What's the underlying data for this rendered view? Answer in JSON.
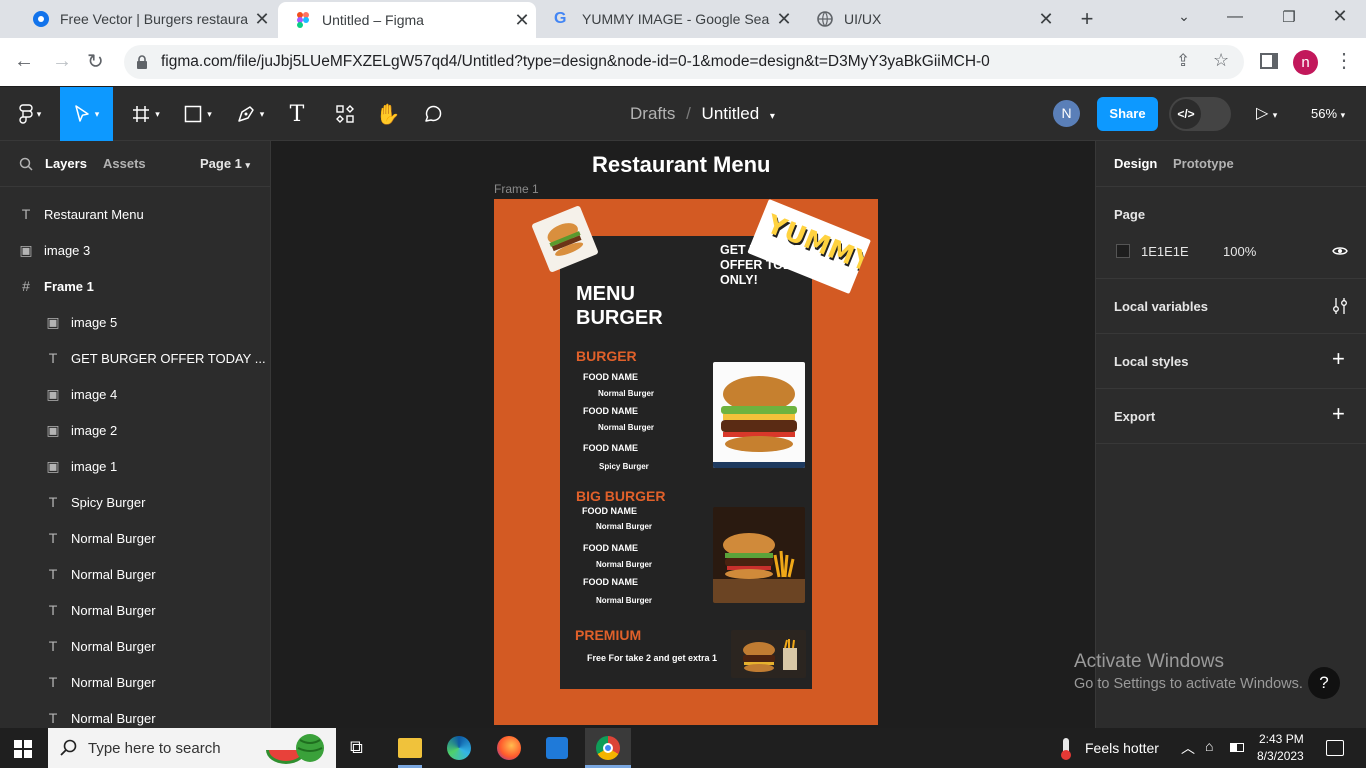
{
  "browser": {
    "tabs": [
      {
        "title": "Free Vector | Burgers restaurant"
      },
      {
        "title": "Untitled – Figma"
      },
      {
        "title": "YUMMY IMAGE - Google Search"
      },
      {
        "title": "UI/UX"
      }
    ],
    "url": "figma.com/file/juJbj5LUeMFXZELgW57qd4/Untitled?type=design&node-id=0-1&mode=design&t=D3MyY3yaBkGiiMCH-0",
    "profile_initial": "n"
  },
  "figma": {
    "breadcrumb_drafts": "Drafts",
    "breadcrumb_sep": "/",
    "file_name": "Untitled",
    "user_initial": "N",
    "share_label": "Share",
    "zoom": "56%",
    "left_tabs": {
      "layers": "Layers",
      "assets": "Assets",
      "page": "Page 1"
    },
    "layers": [
      {
        "name": "Restaurant Menu",
        "icon": "text-icon"
      },
      {
        "name": "image 3",
        "icon": "image-icon"
      },
      {
        "name": "Frame 1",
        "icon": "frame-icon"
      },
      {
        "name": "image 5",
        "icon": "image-icon"
      },
      {
        "name": "GET BURGER OFFER TODAY ...",
        "icon": "text-icon"
      },
      {
        "name": "image 4",
        "icon": "image-icon"
      },
      {
        "name": "image 2",
        "icon": "image-icon"
      },
      {
        "name": "image 1",
        "icon": "image-icon"
      },
      {
        "name": "Spicy Burger",
        "icon": "text-icon"
      },
      {
        "name": "Normal Burger",
        "icon": "text-icon"
      },
      {
        "name": "Normal Burger",
        "icon": "text-icon"
      },
      {
        "name": "Normal Burger",
        "icon": "text-icon"
      },
      {
        "name": "Normal Burger",
        "icon": "text-icon"
      },
      {
        "name": "Normal Burger",
        "icon": "text-icon"
      },
      {
        "name": "Normal Burger",
        "icon": "text-icon"
      }
    ],
    "right_tabs": {
      "design": "Design",
      "prototype": "Prototype"
    },
    "page_section": {
      "title": "Page",
      "color_hex": "1E1E1E",
      "opacity": "100%"
    },
    "sections": {
      "local_variables": "Local variables",
      "local_styles": "Local styles",
      "export": "Export"
    },
    "colors": {
      "accent": "#0d99ff",
      "frame_bg": "#d35a23",
      "card_bg": "#232323",
      "heading": "#e0602a"
    }
  },
  "canvas": {
    "page_title": "Restaurant Menu",
    "frame_label": "Frame 1",
    "offer_text": "GET BURGER OFFER TODAY ONLY!",
    "yummy": "YUMMY!",
    "menu_title_1": "MENU",
    "menu_title_2": "BURGER",
    "section1": "BURGER",
    "section2": "BIG BURGER",
    "section3": "PREMIUM",
    "food_label": "FOOD NAME",
    "normal": "Normal Burger",
    "spicy": "Spicy Burger",
    "premium_text": "Free For take 2 and get extra 1"
  },
  "windows": {
    "activate_title": "Activate Windows",
    "activate_sub": "Go to Settings to activate Windows.",
    "help": "?"
  },
  "taskbar": {
    "search_placeholder": "Type here to search",
    "weather": "Feels hotter",
    "time": "2:43 PM",
    "date": "8/3/2023"
  }
}
